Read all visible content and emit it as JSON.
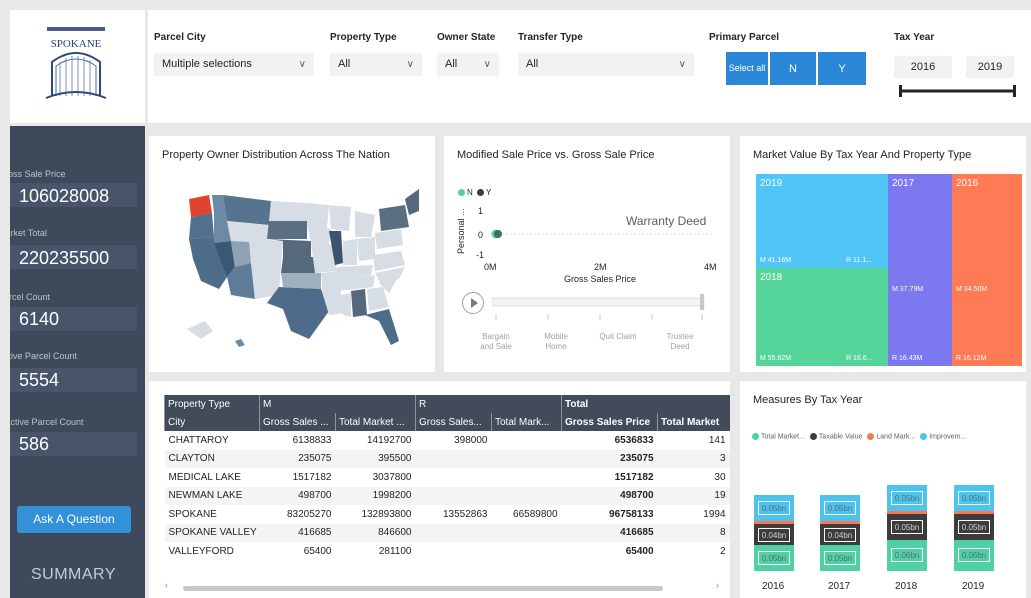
{
  "logo": {
    "text": "SPOKANE"
  },
  "kpis": [
    {
      "label": "Gross Sale Price",
      "value": "106028008"
    },
    {
      "label": "Market Total",
      "value": "220235500"
    },
    {
      "label": "Parcel Count",
      "value": "6140"
    },
    {
      "label": "Active Parcel Count",
      "value": "5554"
    },
    {
      "label": "Inactive Parcel Count",
      "value": "586"
    }
  ],
  "ask_button": "Ask A Question",
  "summary": "SUMMARY",
  "filters": {
    "parcel_city": {
      "label": "Parcel City",
      "value": "Multiple selections"
    },
    "property_type": {
      "label": "Property Type",
      "value": "All"
    },
    "owner_state": {
      "label": "Owner State",
      "value": "All"
    },
    "transfer_type": {
      "label": "Transfer Type",
      "value": "All"
    },
    "primary_parcel": {
      "label": "Primary Parcel",
      "buttons": [
        "Select all",
        "N",
        "Y"
      ]
    },
    "tax_year": {
      "label": "Tax Year",
      "from": "2016",
      "to": "2019"
    }
  },
  "map_card": {
    "title": "Property Owner Distribution Across The Nation"
  },
  "scatter_card": {
    "title": "Modified Sale Price vs. Gross Sale Price",
    "legend": [
      "N",
      "Y"
    ],
    "annotation": "Warranty Deed",
    "ylabel": "Personal ...",
    "yticks": [
      "1",
      "0",
      "-1"
    ],
    "xticks": [
      "0M",
      "2M",
      "4M"
    ],
    "xlabel": "Gross Sales Price",
    "play_axis": [
      "Bargain and Sale",
      "Mobile Home",
      "Quit Claim",
      "Trustee Deed"
    ]
  },
  "treemap_card": {
    "title": "Market Value By Tax Year And Property Type",
    "cells": [
      {
        "year": "2019",
        "labels": [
          "M 41.16M",
          "R 11.1..."
        ]
      },
      {
        "year": "2017",
        "labels": [
          "M 37.79M",
          "R 16.43M"
        ]
      },
      {
        "year": "2016",
        "labels": [
          "M 34.50M",
          "R 16.12M"
        ]
      },
      {
        "year": "2018",
        "labels": [
          "M 55.62M",
          "R 16.6..."
        ]
      }
    ]
  },
  "table": {
    "header_groups": [
      "Property Type",
      "M",
      "R",
      "Total"
    ],
    "columns": [
      "City",
      "Gross Sales ...",
      "Total Market ...",
      "Gross Sales...",
      "Total Mark...",
      "Gross Sales Price",
      "Total Market"
    ],
    "rows": [
      [
        "CHATTAROY",
        "6138833",
        "14192700",
        "398000",
        "",
        "6536833",
        "141"
      ],
      [
        "CLAYTON",
        "235075",
        "395500",
        "",
        "",
        "235075",
        "3"
      ],
      [
        "MEDICAL LAKE",
        "1517182",
        "3037800",
        "",
        "",
        "1517182",
        "30"
      ],
      [
        "NEWMAN LAKE",
        "498700",
        "1998200",
        "",
        "",
        "498700",
        "19"
      ],
      [
        "SPOKANE",
        "83205270",
        "132893800",
        "13552863",
        "66589800",
        "96758133",
        "1994"
      ],
      [
        "SPOKANE VALLEY",
        "416685",
        "846600",
        "",
        "",
        "416685",
        "8"
      ],
      [
        "VALLEYFORD",
        "65400",
        "281100",
        "",
        "",
        "65400",
        "2"
      ]
    ]
  },
  "measures_card": {
    "title": "Measures By Tax Year"
  },
  "colors": {
    "total_market": "#4fd1a5",
    "taxable": "#3c3c3c",
    "land": "#ff7552",
    "improvement": "#4bc5f0",
    "treemap_2019": "#4fc6f5",
    "treemap_2017": "#7b78f0",
    "treemap_2016": "#ff7a55",
    "treemap_2018": "#55d59a"
  },
  "chart_data": {
    "type": "bar",
    "title": "Measures By Tax Year",
    "categories": [
      "2016",
      "2017",
      "2018",
      "2019"
    ],
    "series": [
      {
        "name": "Total Market...",
        "values": [
          0.05,
          0.05,
          0.06,
          0.06
        ]
      },
      {
        "name": "Taxable Value",
        "values": [
          0.04,
          0.04,
          0.05,
          0.05
        ]
      },
      {
        "name": "Land Mark...",
        "values": [
          0.004,
          0.004,
          0.004,
          0.004
        ]
      },
      {
        "name": "Improvem...",
        "values": [
          0.05,
          0.05,
          0.05,
          0.05
        ]
      }
    ],
    "data_labels": [
      [
        "0.05bn",
        "0.04bn",
        "0.05bn"
      ],
      [
        "0.05bn",
        "0.04bn",
        "0.05bn"
      ],
      [
        "0.06bn",
        "0.05bn",
        "0.05bn"
      ],
      [
        "0.06bn",
        "0.05bn",
        "0.05bn"
      ]
    ],
    "units": "bn"
  }
}
